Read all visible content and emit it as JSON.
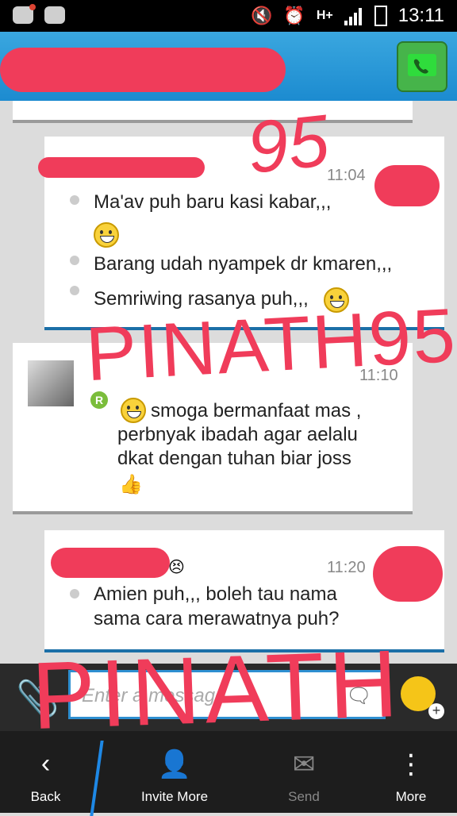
{
  "statusbar": {
    "time": "13:11",
    "network": "H+"
  },
  "header": {
    "title": ""
  },
  "messages": [
    {
      "time": "11:04",
      "lines": [
        "Ma'av puh baru kasi kabar,,,",
        "Barang udah nyampek dr kmaren,,,",
        "Semriwing rasanya puh,,,"
      ]
    },
    {
      "time": "11:10",
      "lines": [
        "smoga bermanfaat mas ,",
        "perbnyak ibadah agar aelalu",
        "dkat dengan tuhan biar joss"
      ],
      "badge": "R"
    },
    {
      "time": "11:20",
      "lines": [
        "Amien puh,,, boleh tau nama",
        "sama cara merawatnya puh?"
      ]
    }
  ],
  "composer": {
    "placeholder": "Enter a message"
  },
  "nav": {
    "back": "Back",
    "invite": "Invite More",
    "send": "Send",
    "more": "More"
  },
  "annotations": {
    "num": "95",
    "text1": "PINATH95",
    "text2": "PINATH"
  },
  "colors": {
    "accent": "#1e88e5",
    "scribble": "#f03c5a",
    "call": "#46b44a"
  }
}
